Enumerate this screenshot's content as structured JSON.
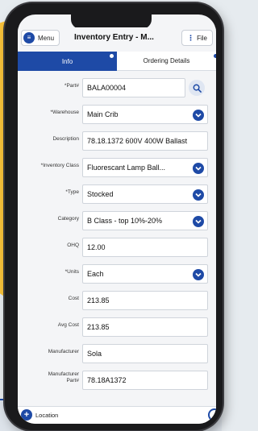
{
  "header": {
    "menu_label": "Menu",
    "title": "Inventory Entry - M...",
    "file_label": "File"
  },
  "tabs": [
    {
      "label": "Info",
      "active": true
    },
    {
      "label": "Ordering Details",
      "active": false
    }
  ],
  "fields": {
    "part": {
      "label": "*Part#",
      "value": "BALA00004"
    },
    "warehouse": {
      "label": "*Warehouse",
      "value": "Main Crib"
    },
    "description": {
      "label": "Description",
      "value": "78.18.1372 600V 400W Ballast"
    },
    "inventory_class": {
      "label": "*Inventory Class",
      "value": "Fluorescant Lamp Ball..."
    },
    "type": {
      "label": "*Type",
      "value": "Stocked"
    },
    "category": {
      "label": "Category",
      "value": "B Class - top 10%-20%"
    },
    "ohq": {
      "label": "OHQ",
      "value": "12.00"
    },
    "units": {
      "label": "*Units",
      "value": "Each"
    },
    "cost": {
      "label": "Cost",
      "value": "213.85"
    },
    "avg_cost": {
      "label": "Avg Cost",
      "value": "213.85"
    },
    "manufacturer": {
      "label": "Manufacturer",
      "value": "Sola"
    },
    "manufacturer_part_line1": "Manufacturer",
    "manufacturer_part_line2": "Part#",
    "manufacturer_part_value": "78.18A1372"
  },
  "footer": {
    "location_label": "Location"
  },
  "colors": {
    "accent": "#1e4aa6",
    "background_shape": "#f8c23a"
  }
}
